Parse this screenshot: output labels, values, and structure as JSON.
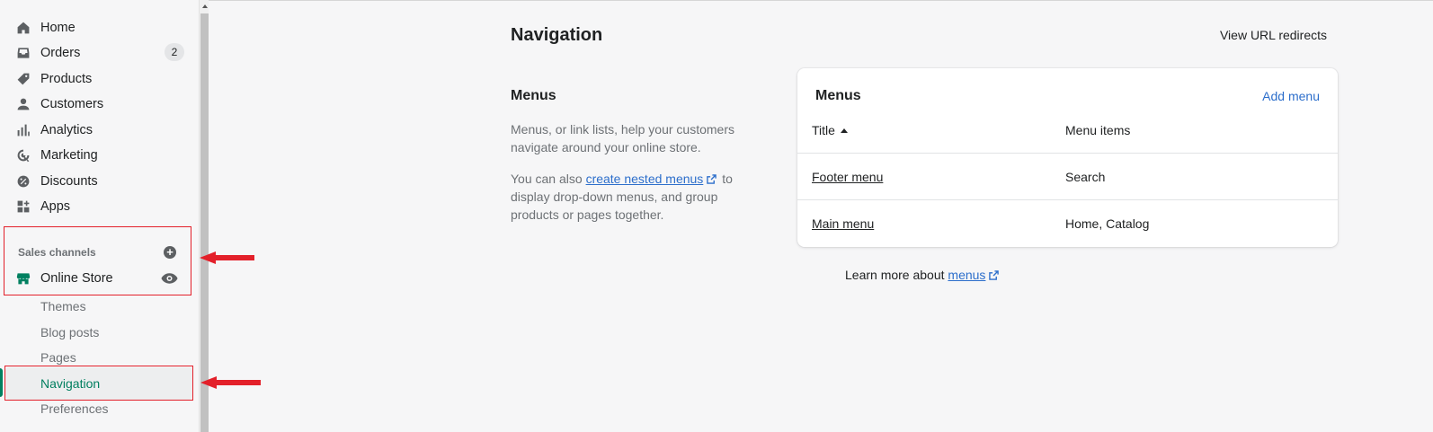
{
  "sidebar": {
    "items": [
      {
        "label": "Home",
        "icon": "home-icon"
      },
      {
        "label": "Orders",
        "icon": "orders-icon",
        "badge": "2"
      },
      {
        "label": "Products",
        "icon": "tag-icon"
      },
      {
        "label": "Customers",
        "icon": "person-icon"
      },
      {
        "label": "Analytics",
        "icon": "bar-chart-icon"
      },
      {
        "label": "Marketing",
        "icon": "target-icon"
      },
      {
        "label": "Discounts",
        "icon": "discount-icon"
      },
      {
        "label": "Apps",
        "icon": "apps-icon"
      }
    ],
    "sales_channels_label": "Sales channels",
    "online_store_label": "Online Store",
    "sub_items": [
      "Themes",
      "Blog posts",
      "Pages",
      "Navigation",
      "Preferences"
    ]
  },
  "header": {
    "title": "Navigation",
    "redirects_label": "View URL redirects"
  },
  "menus_section": {
    "heading": "Menus",
    "desc1": "Menus, or link lists, help your customers navigate around your online store.",
    "desc2_pre": "You can also ",
    "desc2_link": "create nested menus",
    "desc2_post": " to display drop-down menus, and group products or pages together."
  },
  "card": {
    "title": "Menus",
    "add_label": "Add menu",
    "col_title": "Title",
    "col_items": "Menu items",
    "rows": [
      {
        "title": "Footer menu",
        "items": "Search"
      },
      {
        "title": "Main menu",
        "items": "Home, Catalog"
      }
    ]
  },
  "learn_more": {
    "pre": "Learn more about ",
    "link": "menus"
  },
  "colors": {
    "accent_green": "#008060",
    "link_blue": "#2c6ecb",
    "annotation_red": "#e3202a"
  }
}
